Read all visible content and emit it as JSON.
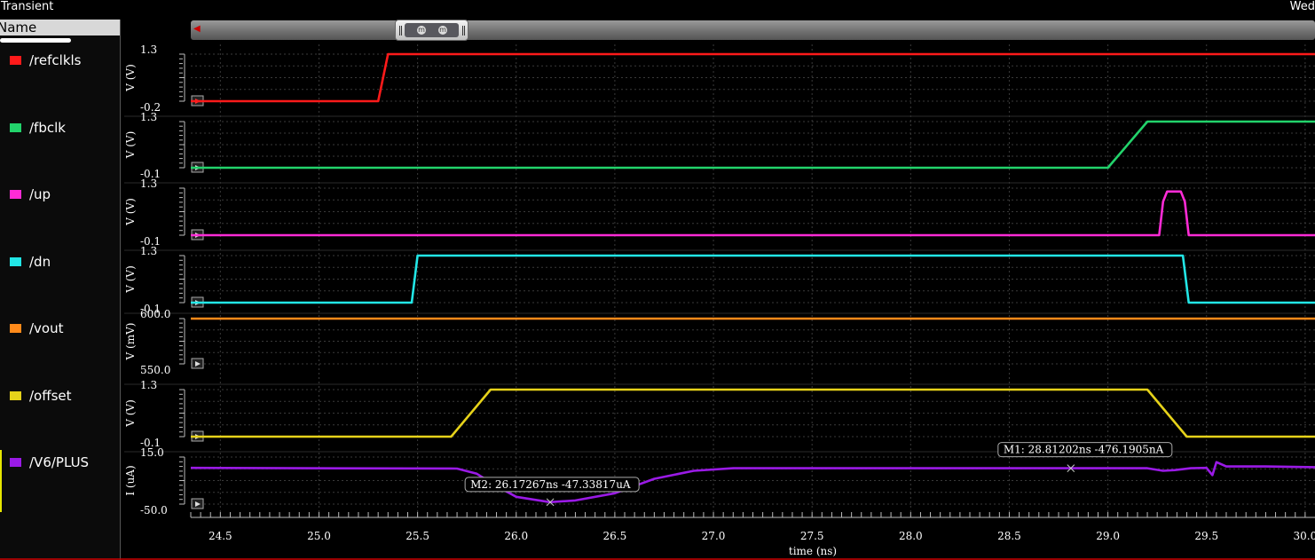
{
  "window": {
    "title": "Transient",
    "title_right": "Wed"
  },
  "sidebar": {
    "header": "Name",
    "signals": [
      {
        "label": "/refclkls",
        "color": "#ff1a1a"
      },
      {
        "label": "/fbclk",
        "color": "#22d36b"
      },
      {
        "label": "/up",
        "color": "#ff2bd6"
      },
      {
        "label": "/dn",
        "color": "#22e6e6"
      },
      {
        "label": "/vout",
        "color": "#ff8a1a"
      },
      {
        "label": "/offset",
        "color": "#e6d21a"
      },
      {
        "label": "/V6/PLUS",
        "color": "#9a1ae6"
      }
    ]
  },
  "chart_data": {
    "type": "line",
    "xlabel": "time (ns)",
    "xlim": [
      24.35,
      30.05
    ],
    "x_ticks": [
      "24.5",
      "25.0",
      "25.5",
      "26.0",
      "26.5",
      "27.0",
      "27.5",
      "28.0",
      "28.5",
      "29.0",
      "29.5",
      "30.0"
    ],
    "x_tick_values": [
      24.5,
      25.0,
      25.5,
      26.0,
      26.5,
      27.0,
      27.5,
      28.0,
      28.5,
      29.0,
      29.5,
      30.0
    ],
    "strips": [
      {
        "name": "/refclkls",
        "ylabel": "V (V)",
        "y_top": "1.3",
        "y_bottom": "-0.2",
        "ylim": [
          -0.2,
          1.3
        ],
        "x": [
          24.35,
          25.3,
          25.35,
          30.05
        ],
        "y": [
          -0.2,
          -0.2,
          1.3,
          1.3
        ]
      },
      {
        "name": "/fbclk",
        "ylabel": "V (V)",
        "y_top": "1.3",
        "y_bottom": "-0.1",
        "ylim": [
          -0.1,
          1.3
        ],
        "x": [
          24.35,
          29.0,
          29.2,
          30.05
        ],
        "y": [
          -0.1,
          -0.1,
          1.3,
          1.3
        ]
      },
      {
        "name": "/up",
        "ylabel": "V (V)",
        "y_top": "1.3",
        "y_bottom": "-0.1",
        "ylim": [
          -0.1,
          1.3
        ],
        "x": [
          24.35,
          29.26,
          29.28,
          29.3,
          29.37,
          29.39,
          29.41,
          30.05
        ],
        "y": [
          -0.1,
          -0.1,
          0.9,
          1.2,
          1.2,
          0.9,
          -0.1,
          -0.1
        ]
      },
      {
        "name": "/dn",
        "ylabel": "V (V)",
        "y_top": "1.3",
        "y_bottom": "-0.1",
        "ylim": [
          -0.1,
          1.3
        ],
        "x": [
          24.35,
          25.47,
          25.5,
          29.38,
          29.41,
          30.05
        ],
        "y": [
          -0.1,
          -0.1,
          1.3,
          1.3,
          -0.1,
          -0.1
        ]
      },
      {
        "name": "/vout",
        "ylabel": "V (mV)",
        "y_top": "600.0",
        "y_bottom": "550.0",
        "ylim": [
          550,
          600
        ],
        "x": [
          24.35,
          30.05
        ],
        "y": [
          600,
          600
        ]
      },
      {
        "name": "/offset",
        "ylabel": "V (V)",
        "y_top": "1.3",
        "y_bottom": "-0.1",
        "ylim": [
          -0.1,
          1.3
        ],
        "x": [
          24.35,
          25.67,
          25.87,
          29.2,
          29.4,
          30.05
        ],
        "y": [
          -0.1,
          -0.1,
          1.3,
          1.3,
          -0.1,
          -0.1
        ]
      },
      {
        "name": "/V6/PLUS",
        "ylabel": "I (uA)",
        "y_top": "15.0",
        "y_bottom": "-50.0",
        "ylim": [
          -50,
          15
        ],
        "x": [
          24.35,
          25.7,
          25.8,
          25.9,
          26.0,
          26.17,
          26.3,
          26.5,
          26.7,
          26.9,
          27.1,
          27.5,
          28.5,
          29.2,
          29.28,
          29.34,
          29.42,
          29.5,
          29.53,
          29.55,
          29.6,
          29.8,
          30.05
        ],
        "y": [
          0,
          -1,
          -8,
          -25,
          -40,
          -47.3,
          -45,
          -35,
          -15,
          -4,
          -0.5,
          -0.5,
          -0.5,
          -0.5,
          -4,
          -3,
          -0.5,
          0,
          -10,
          8,
          2,
          2,
          1
        ]
      }
    ],
    "markers": [
      {
        "label": "M1: 28.81202ns -476.1905nA",
        "strip": 6,
        "x": 28.812,
        "y": -0.476
      },
      {
        "label": "M2: 26.17267ns -47.33817uA",
        "strip": 6,
        "x": 26.17267,
        "y": -47.33817
      }
    ]
  }
}
